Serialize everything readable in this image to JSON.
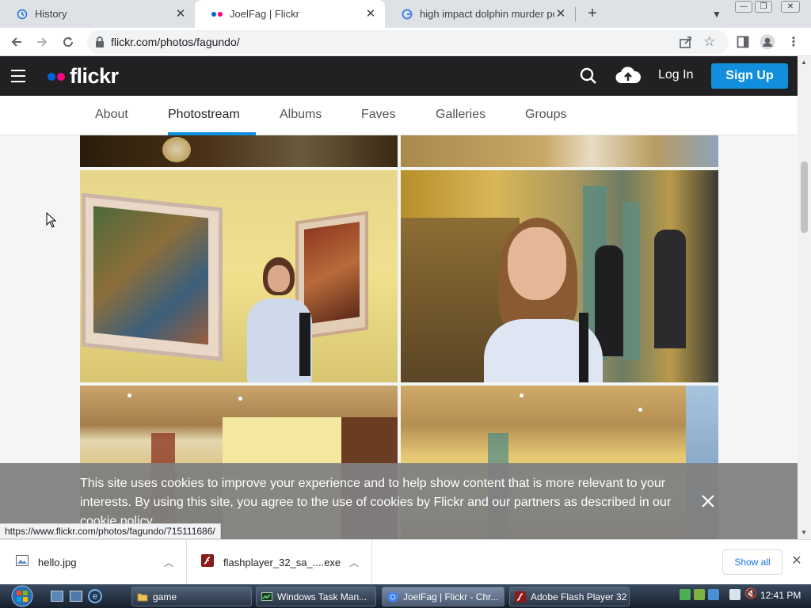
{
  "browser": {
    "tabs": [
      {
        "title": "History",
        "icon": "history-icon"
      },
      {
        "title": "JoelFag | Flickr",
        "icon": "flickr-favicon",
        "active": true
      },
      {
        "title": "high impact dolphin murder porn",
        "icon": "google-favicon"
      }
    ],
    "url": "flickr.com/photos/fagundo/",
    "status_url": "https://www.flickr.com/photos/fagundo/715111686/"
  },
  "flickr": {
    "logo_text": "flickr",
    "login_label": "Log In",
    "signup_label": "Sign Up",
    "brand_colors": {
      "blue": "#0063dc",
      "pink": "#ff0084",
      "accent": "#128fdc"
    },
    "subnav": [
      {
        "label": "About"
      },
      {
        "label": "Photostream",
        "active": true
      },
      {
        "label": "Albums"
      },
      {
        "label": "Faves"
      },
      {
        "label": "Galleries"
      },
      {
        "label": "Groups"
      }
    ]
  },
  "cookie_banner": {
    "text": "This site uses cookies to improve your experience and to help show content that is more relevant to your interests. By using this site, you agree to the use of cookies by Flickr and our partners as described in our cookie policy."
  },
  "downloads": {
    "items": [
      {
        "name": "hello.jpg",
        "icon": "image-file-icon"
      },
      {
        "name": "flashplayer_32_sa_....exe",
        "icon": "flash-file-icon"
      }
    ],
    "show_all_label": "Show all"
  },
  "taskbar": {
    "buttons": [
      {
        "label": "game",
        "icon": "folder-icon"
      },
      {
        "label": "Windows Task Man...",
        "icon": "task-manager-icon"
      },
      {
        "label": "JoelFag | Flickr - Chr...",
        "icon": "chrome-icon",
        "active": true
      },
      {
        "label": "Adobe Flash Player 32",
        "icon": "flash-icon"
      }
    ],
    "clock": "12:41 PM"
  }
}
